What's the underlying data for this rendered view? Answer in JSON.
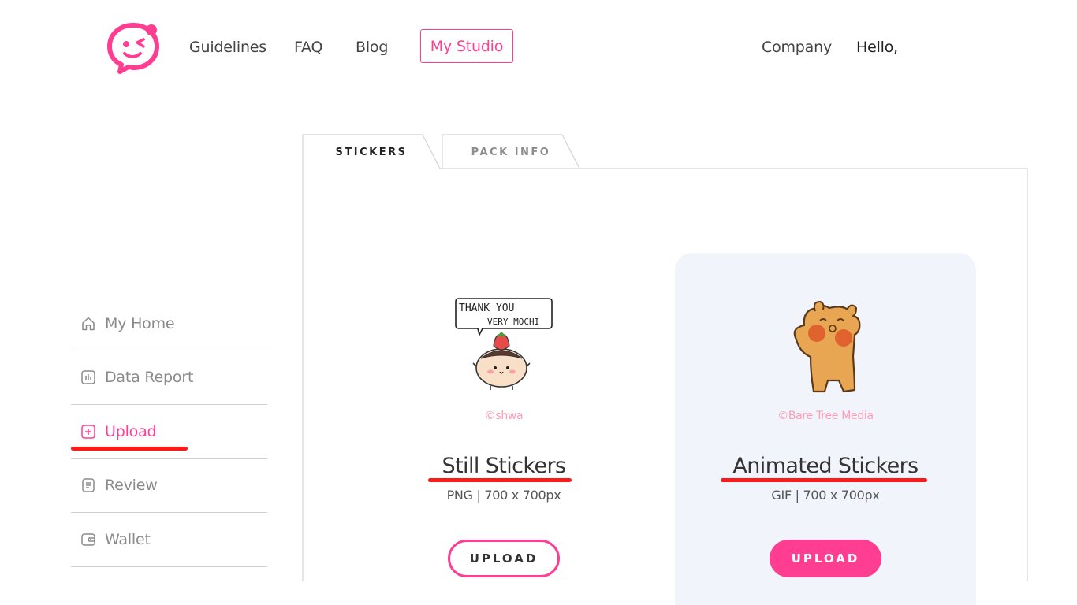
{
  "header": {
    "logo_icon": "winking-face-chat-bubble-icon",
    "brand_color": "#ff3d91",
    "nav": {
      "guidelines": "Guidelines",
      "faq": "FAQ",
      "blog": "Blog",
      "my_studio": "My Studio",
      "company": "Company",
      "hello": "Hello,"
    }
  },
  "tabs": [
    {
      "label": "STICKERS",
      "active": true
    },
    {
      "label": "PACK INFO",
      "active": false
    }
  ],
  "sidebar": {
    "items": [
      {
        "label": "My Home",
        "icon": "home-icon",
        "active": false
      },
      {
        "label": "Data Report",
        "icon": "bar-chart-icon",
        "active": false
      },
      {
        "label": "Upload",
        "icon": "plus-square-icon",
        "active": true
      },
      {
        "label": "Review",
        "icon": "document-icon",
        "active": false
      },
      {
        "label": "Wallet",
        "icon": "wallet-icon",
        "active": false
      }
    ],
    "annotation_color": "#ff1a1a"
  },
  "cards": {
    "still": {
      "sticker_text_line1": "THANK YOU",
      "sticker_text_line2": "VERY MOCHI",
      "credit": "©shwa",
      "title": "Still Stickers",
      "spec": "PNG | 700 x 700px",
      "button": "UPLOAD"
    },
    "animated": {
      "credit": "©Bare Tree Media",
      "title": "Animated Stickers",
      "spec": "GIF | 700 x 700px",
      "button": "UPLOAD"
    }
  }
}
